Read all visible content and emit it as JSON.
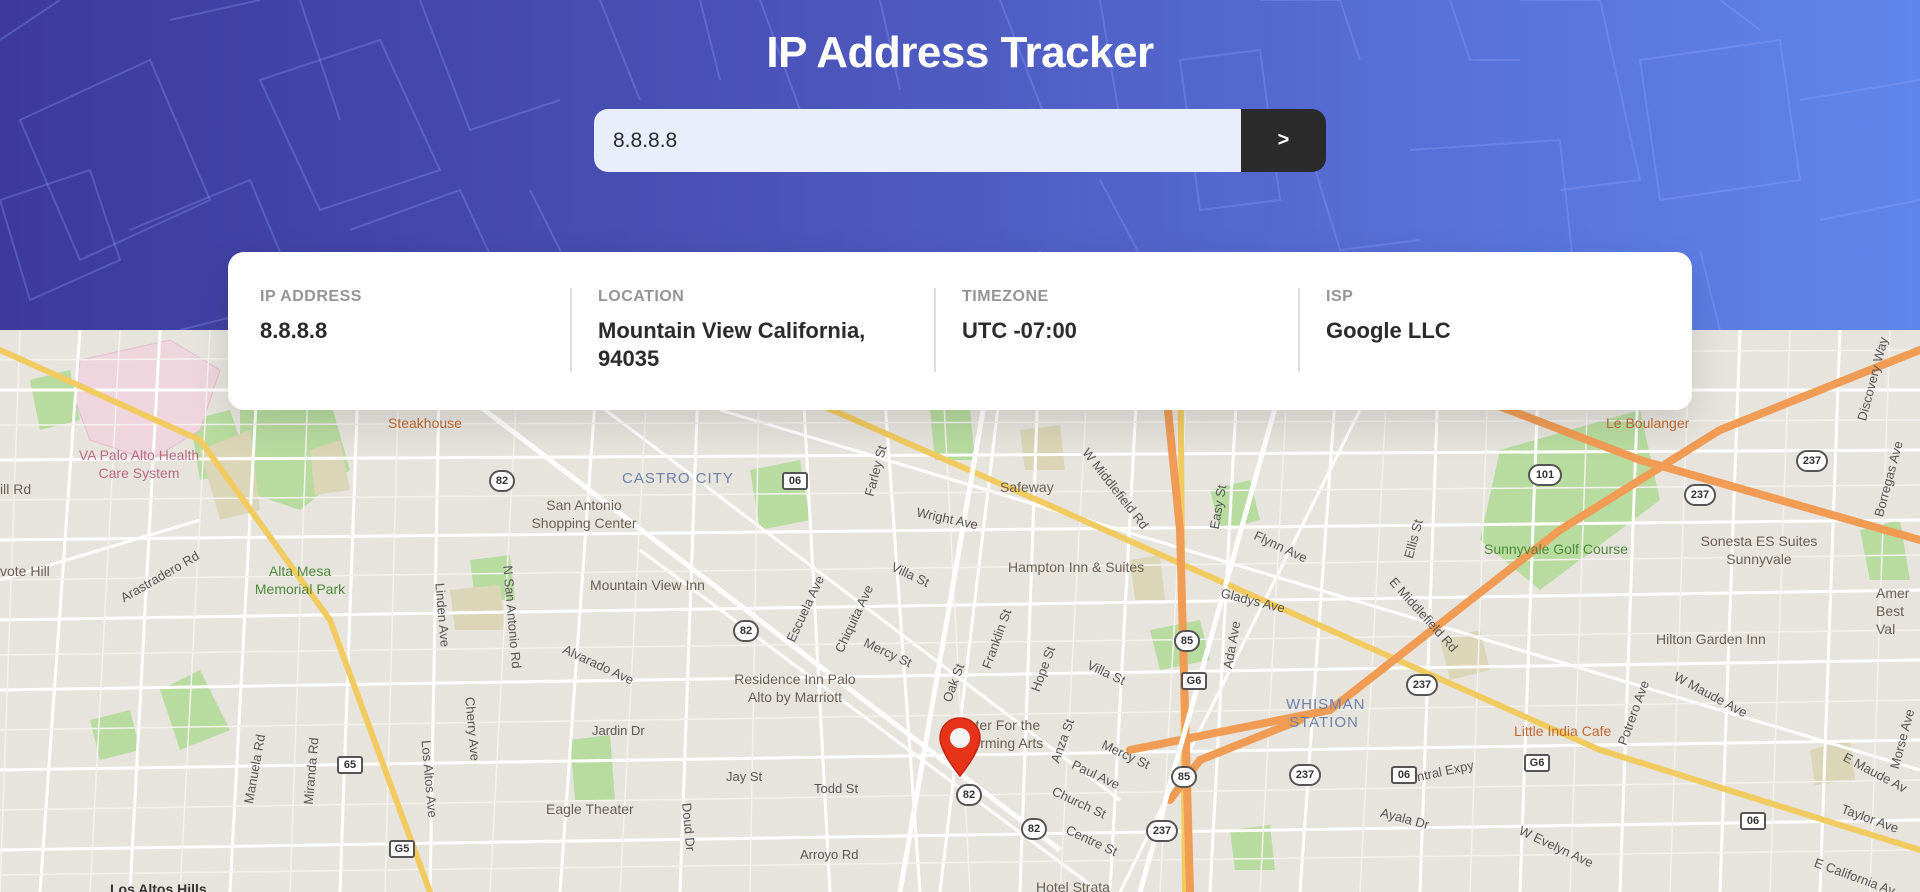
{
  "app": {
    "title": "IP Address Tracker"
  },
  "search": {
    "value": "8.8.8.8",
    "button_label": ">"
  },
  "info": {
    "ip_label": "IP ADDRESS",
    "ip_value": "8.8.8.8",
    "location_label": "LOCATION",
    "location_value": "Mountain View California, 94035",
    "timezone_label": "TIMEZONE",
    "timezone_value": "UTC -07:00",
    "isp_label": "ISP",
    "isp_value": "Google LLC"
  },
  "map": {
    "labels": {
      "va_palo_alto": "VA Palo Alto Health Care System",
      "steakhouse": "Steakhouse",
      "castro_city": "CASTRO CITY",
      "san_antonio_shopping": "San Antonio Shopping Center",
      "safeway": "Safeway",
      "le_boulanger": "Le Boulanger",
      "sonesta": "Sonesta ES Suites Sunnyvale",
      "sunnyvale_golf": "Sunnyvale Golf Course",
      "alta_mesa": "Alta Mesa Memorial Park",
      "mountain_view_inn": "Mountain View Inn",
      "hampton_inn": "Hampton Inn & Suites",
      "residence_inn": "Residence Inn Palo Alto by Marriott",
      "whisman_station": "WHISMAN STATION",
      "hilton_garden": "Hilton Garden Inn",
      "little_india": "Little India Cafe",
      "center_arts": "Center For the Performing Arts",
      "eagle_theater": "Eagle Theater",
      "hotel_strata": "Hotel Strata",
      "los_altos_hills": "Los Altos Hills",
      "vote_hill": "vote Hill",
      "ill_rd": "ill Rd",
      "amer_best": "Amer Best Val",
      "arastradero": "Arastradero Rd",
      "wright_ave": "Wright Ave",
      "villa_st": "Villa St",
      "villa_st2": "Villa St",
      "w_middlefield": "W Middlefield Rd",
      "e_middlefield": "E Middlefield Rd",
      "flynn_ave": "Flynn Ave",
      "gladys_ave": "Gladys Ave",
      "ellis_st": "Ellis St",
      "easy_st": "Easy St",
      "ada_ave": "Ada Ave",
      "n_san_antonio": "N San Antonio Rd",
      "linden_ave": "Linden Ave",
      "alvarado": "Alvarado Ave",
      "escuela": "Escuela Ave",
      "chiquita": "Chiquita Ave",
      "mercy_st": "Mercy St",
      "mercy_st2": "Mercy St",
      "oak_st": "Oak St",
      "franklin": "Franklin St",
      "hope_st": "Hope St",
      "anza_st": "Anza St",
      "paul_ave": "Paul Ave",
      "church_st": "Church St",
      "centre_st": "Centre St",
      "jardin": "Jardin Dr",
      "jay_st": "Jay St",
      "todd_st": "Todd St",
      "arroyo": "Arroyo Rd",
      "doud_dr": "Doud Dr",
      "cherry_ave": "Cherry Ave",
      "los_altos_ave": "Los Altos Ave",
      "miranda": "Miranda Rd",
      "manuela": "Manuela Rd",
      "farley": "Farley St",
      "central_expy": "Central Expy",
      "ayala": "Ayala Dr",
      "w_evelyn": "W Evelyn Ave",
      "potrero": "Potrero Ave",
      "w_maude": "W Maude Ave",
      "e_maude": "E Maude Av",
      "taylor": "Taylor Ave",
      "morse": "Morse Ave",
      "borregas": "Borregas Ave",
      "discovery": "Discovery Way",
      "e_california": "E California Av"
    },
    "shields": [
      "82",
      "06",
      "82",
      "85",
      "G6",
      "85",
      "237",
      "237",
      "06",
      "G6",
      "06",
      "101",
      "237",
      "237",
      "237",
      "82",
      "82",
      "65",
      "G5"
    ]
  }
}
